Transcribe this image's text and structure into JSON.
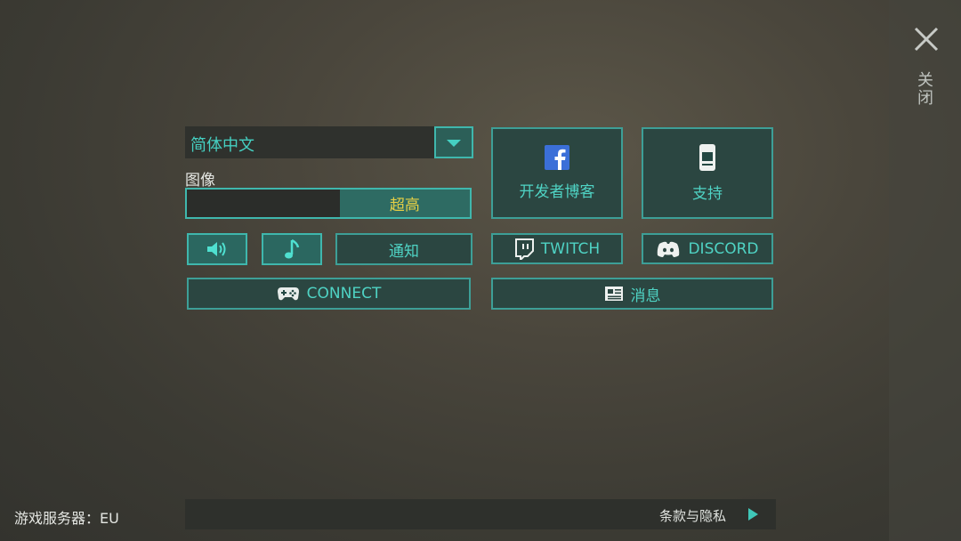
{
  "close": {
    "label": "关闭"
  },
  "language": {
    "value": "简体中文"
  },
  "graphics": {
    "label": "图像",
    "value": "超高",
    "level_fraction": 0.46
  },
  "buttons": {
    "notify": "通知",
    "connect": "CONNECT",
    "dev_blog": "开发者博客",
    "support": "支持",
    "twitch": "TWITCH",
    "discord": "DISCORD",
    "news": "消息"
  },
  "footer": {
    "server_label": "游戏服务器：",
    "server_value": "EU",
    "terms": "条款与隐私"
  },
  "colors": {
    "accent": "#3fb7ad",
    "quality_text": "#e6cf45"
  }
}
